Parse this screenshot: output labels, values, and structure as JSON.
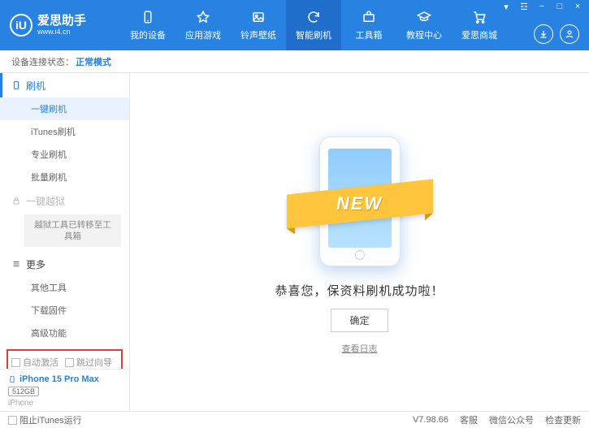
{
  "logo": {
    "glyph": "iU",
    "title": "爱思助手",
    "url": "www.i4.cn"
  },
  "nav": [
    {
      "label": "我的设备"
    },
    {
      "label": "应用游戏"
    },
    {
      "label": "铃声壁纸"
    },
    {
      "label": "智能刷机"
    },
    {
      "label": "工具箱"
    },
    {
      "label": "教程中心"
    },
    {
      "label": "爱思商城"
    }
  ],
  "status": {
    "label": "设备连接状态：",
    "value": "正常模式"
  },
  "sidebar": {
    "flash": {
      "header": "刷机",
      "items": [
        "一键刷机",
        "iTunes刷机",
        "专业刷机",
        "批量刷机"
      ]
    },
    "jailbreak": {
      "header": "一键越狱",
      "note": "越狱工具已转移至工具箱"
    },
    "more": {
      "header": "更多",
      "items": [
        "其他工具",
        "下载固件",
        "高级功能"
      ]
    },
    "checks": {
      "auto_activate": "自动激活",
      "skip_guide": "跳过向导"
    },
    "device": {
      "name": "iPhone 15 Pro Max",
      "storage": "512GB",
      "type": "iPhone"
    }
  },
  "main": {
    "ribbon": "NEW",
    "success": "恭喜您，保资料刷机成功啦！",
    "ok": "确定",
    "log": "查看日志"
  },
  "footer": {
    "block_itunes": "阻止iTunes运行",
    "version": "V7.98.66",
    "links": [
      "客服",
      "微信公众号",
      "检查更新"
    ]
  }
}
